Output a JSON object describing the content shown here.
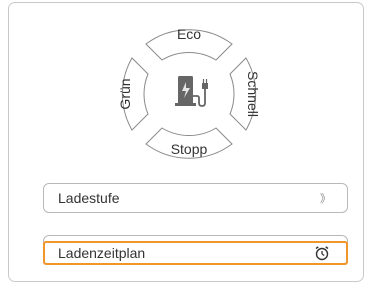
{
  "dpad": {
    "top_label": "Eco",
    "right_label": "Schnell",
    "bottom_label": "Stopp",
    "left_label": "Grün",
    "center_icon": "ev-charger-icon"
  },
  "menu": {
    "items": [
      {
        "label": "Ladestufe",
        "trailing_icon": "double-chevron-right-icon",
        "trailing_text": "》"
      },
      {
        "label": "Ladenzeitplan",
        "trailing_icon": "alarm-clock-icon",
        "selected": true
      }
    ]
  },
  "colors": {
    "accent": "#f0962a",
    "border": "#b8b8b8",
    "text": "#333333",
    "icon_fill": "#666666",
    "bolt": "#e6e6e6"
  }
}
